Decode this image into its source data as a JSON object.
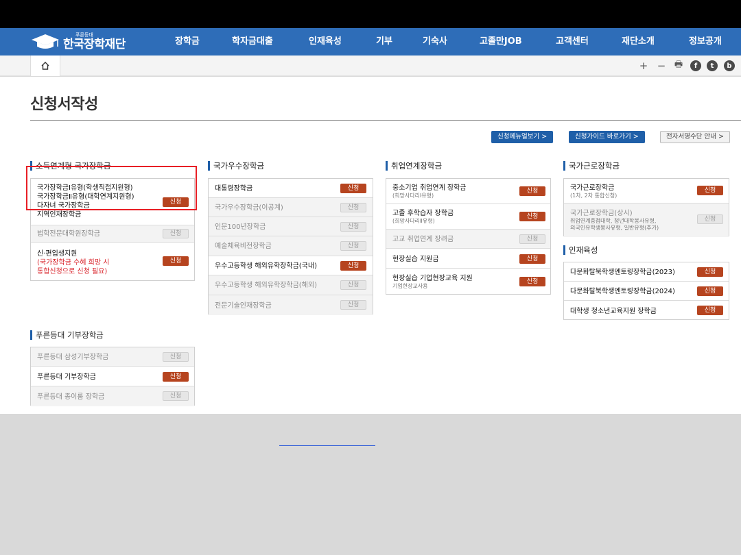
{
  "logo": {
    "small": "푸른등대",
    "main": "한국장학재단"
  },
  "nav": [
    "장학금",
    "학자금대출",
    "인재육성",
    "기부",
    "기숙사",
    "고졸만JOB",
    "고객센터",
    "재단소개",
    "정보공개"
  ],
  "toolbar": {
    "zoom_in": "+",
    "zoom_out": "−",
    "print": "🖶",
    "facebook": "f",
    "twitter": "t",
    "blog": "b"
  },
  "page_title": "신청서작성",
  "top_buttons": {
    "manual": "신청메뉴얼보기 >",
    "guide": "신청가이드 바로가기 >",
    "esign": "전자서명수단 안내 >"
  },
  "badge_label": "신청",
  "sections": {
    "income": {
      "title": "소득연계형 국가장학금",
      "main_lines": [
        "국가장학금Ⅰ유형(학생직접지원형)",
        "국가장학금Ⅱ유형(대학연계지원형)",
        "다자녀 국가장학금",
        "지역인재장학금"
      ],
      "law": "법학전문대학원장학금",
      "transfer_title": "신·편입생지원",
      "transfer_note1": "(국가장학금 수혜 희망 시",
      "transfer_note2": "통합신청으로 신청 필요)"
    },
    "excellence": {
      "title": "국가우수장학금",
      "items": [
        "대통령장학금",
        "국가우수장학금(이공계)",
        "인문100년장학금",
        "예술체육비전장학금",
        "우수고등학생 해외유학장학금(국내)",
        "우수고등학생 해외유학장학금(해외)",
        "전문기술인재장학금"
      ]
    },
    "employment": {
      "title": "취업연계장학금",
      "items": [
        {
          "name": "중소기업 취업연계 장학금",
          "sub": "(희망사다리Ⅰ유형)"
        },
        {
          "name": "고졸 후학습자 장학금",
          "sub": "(희망사다리Ⅱ유형)"
        },
        {
          "name": "고교 취업연계 장려금",
          "sub": ""
        },
        {
          "name": "현장실습 지원금",
          "sub": ""
        },
        {
          "name": "현장실습 기업현장교육 지원",
          "sub": "기업현장교사용"
        }
      ]
    },
    "work": {
      "title": "국가근로장학금",
      "items": [
        {
          "name": "국가근로장학금",
          "sub": "(1차, 2차 통합신청)"
        },
        {
          "name": "국가근로장학금(상시)",
          "sub": "취업연계중점대학, 청년대학봉사유형,",
          "sub2": "외국인유학생봉사유형, 일반유형(추가)"
        }
      ]
    },
    "talent": {
      "title": "인재육성",
      "items": [
        "다문화탈북학생멘토링장학금(2023)",
        "다문화탈북학생멘토링장학금(2024)",
        "대학생 청소년교육지원 장학금"
      ]
    },
    "donation": {
      "title": "푸른등대 기부장학금",
      "items": [
        "푸른등대 삼성기부장학금",
        "푸른등대 기부장학금",
        "푸른등대 종이룸 장학금"
      ]
    }
  }
}
